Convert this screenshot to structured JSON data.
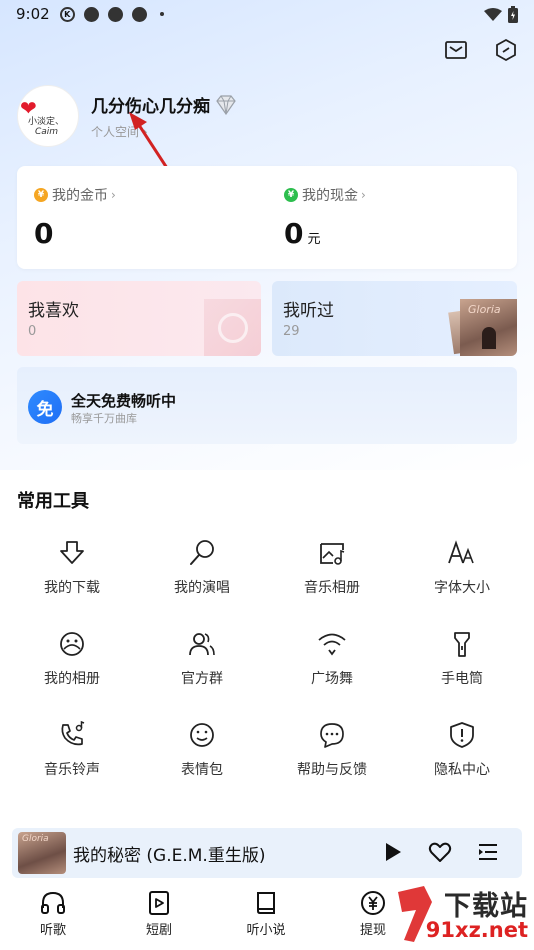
{
  "status_bar": {
    "time": "9:02",
    "icons": [
      "k-circle-icon",
      "ring-icon",
      "ring-icon",
      "ring-icon",
      "dot-icon"
    ],
    "right_icons": [
      "wifi-icon",
      "battery-icon"
    ]
  },
  "header": {
    "icons": [
      "mail-icon",
      "cube-icon"
    ]
  },
  "profile": {
    "username": "几分伤心几分痴",
    "subtitle": "个人空间",
    "avatar_text_1": "小淡定、",
    "avatar_text_2": "Caim",
    "badge_icon": "diamond-icon"
  },
  "wallet": {
    "coins_label": "我的金币",
    "coins_value": "0",
    "cash_label": "我的现金",
    "cash_value": "0",
    "cash_unit": "元"
  },
  "cards": {
    "like_title": "我喜欢",
    "like_count": "0",
    "heard_title": "我听过",
    "heard_count": "29"
  },
  "promo": {
    "badge": "免",
    "title": "全天免费畅听中",
    "subtitle": "畅享千万曲库"
  },
  "tools": {
    "section_title": "常用工具",
    "items": [
      {
        "label": "我的下载",
        "icon": "download-icon"
      },
      {
        "label": "我的演唱",
        "icon": "microphone-icon"
      },
      {
        "label": "音乐相册",
        "icon": "music-album-icon"
      },
      {
        "label": "字体大小",
        "icon": "font-size-icon"
      },
      {
        "label": "我的相册",
        "icon": "photo-album-icon"
      },
      {
        "label": "官方群",
        "icon": "group-icon"
      },
      {
        "label": "广场舞",
        "icon": "square-dance-icon"
      },
      {
        "label": "手电筒",
        "icon": "flashlight-icon"
      },
      {
        "label": "音乐铃声",
        "icon": "ringtone-icon"
      },
      {
        "label": "表情包",
        "icon": "emoji-icon"
      },
      {
        "label": "帮助与反馈",
        "icon": "help-feedback-icon"
      },
      {
        "label": "隐私中心",
        "icon": "privacy-icon"
      }
    ]
  },
  "player": {
    "title": "我的秘密 (G.E.M.重生版)",
    "cover_text": "Gloria"
  },
  "nav": {
    "items": [
      {
        "label": "听歌",
        "icon": "headphones-icon"
      },
      {
        "label": "短剧",
        "icon": "short-drama-icon"
      },
      {
        "label": "听小说",
        "icon": "book-icon"
      },
      {
        "label": "提现",
        "icon": "withdraw-icon"
      }
    ]
  },
  "watermark": {
    "big": "下载站",
    "small": "91xz.net"
  },
  "colors": {
    "accent_blue": "#1f6ef5",
    "annotation_red": "#d22222",
    "like_card": "#fde3e7",
    "heard_card": "#dce9fb",
    "player_bg": "#e9f1fb"
  }
}
